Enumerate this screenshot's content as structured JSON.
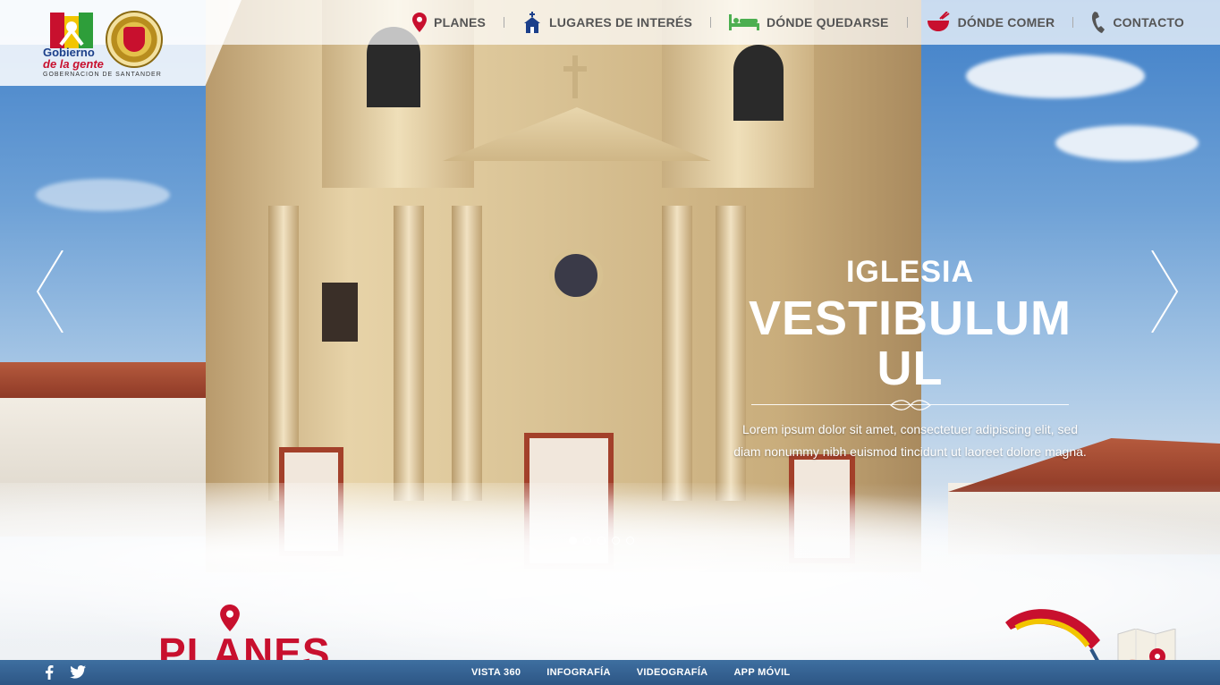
{
  "brand": {
    "logo_line1": "Gobierno",
    "logo_line2": "de la gente",
    "caption": "GOBERNACION DE SANTANDER"
  },
  "nav": {
    "items": [
      {
        "label": "PLANES",
        "icon": "map-pin-icon"
      },
      {
        "label": "LUGARES DE INTERÉS",
        "icon": "church-icon"
      },
      {
        "label": "DÓNDE QUEDARSE",
        "icon": "bed-icon"
      },
      {
        "label": "DÓNDE COMER",
        "icon": "food-bowl-icon"
      },
      {
        "label": "CONTACTO",
        "icon": "phone-icon"
      }
    ],
    "colors": {
      "pin": "#c8102e",
      "church": "#1b3f8a",
      "bed": "#4caf50",
      "food": "#c8102e",
      "phone": "#555555"
    }
  },
  "slider": {
    "kicker": "IGLESIA",
    "title": "VESTIBULUM UL",
    "text": "Lorem ipsum dolor sit amet, consectetuer adipiscing elit, sed diam nonummy nibh euismod tincidunt ut laoreet dolore magna.",
    "dots_total": 5,
    "active_dot": 1
  },
  "section": {
    "label": "PLANES",
    "accent": "#c8102e"
  },
  "footer": {
    "links": [
      "VISTA 360",
      "INFOGRAFÍA",
      "VIDEOGRAFÍA",
      "APP MÓVIL"
    ],
    "social": [
      "facebook-icon",
      "twitter-icon"
    ],
    "bg": "#34618f"
  }
}
